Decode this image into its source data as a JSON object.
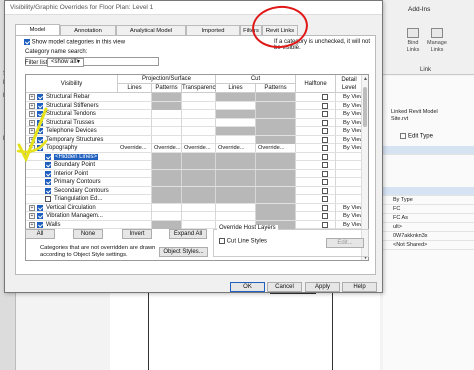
{
  "dialog": {
    "title": "Visibility/Graphic Overrides for Floor Plan: Level 1",
    "tabs": [
      {
        "label": "Model Categories"
      },
      {
        "label": "Annotation Categories"
      },
      {
        "label": "Analytical Model Categories"
      },
      {
        "label": "Imported Categories"
      },
      {
        "label": "Filters"
      },
      {
        "label": "Revit Links"
      }
    ],
    "show_model_categories_label": "Show model categories in this view",
    "note": "If a category is unchecked, it will not be visible.",
    "category_search_label": "Category name search:",
    "category_search_value": "",
    "filter_list_label": "Filter list:",
    "filter_list_value": "<show all>",
    "columns": {
      "visibility": "Visibility",
      "projection_surface": "Projection/Surface",
      "cut": "Cut",
      "halftone": "Halftone",
      "detail_level_1": "Detail",
      "detail_level_2": "Level",
      "lines": "Lines",
      "patterns": "Patterns",
      "transparency": "Transparency",
      "cut_lines": "Lines",
      "cut_patterns": "Patterns"
    },
    "rows": [
      {
        "name": "Structural Rebar",
        "detail": "By View"
      },
      {
        "name": "Structural Stiffeners",
        "detail": "By View"
      },
      {
        "name": "Structural Tendons",
        "detail": "By View"
      },
      {
        "name": "Structural Trusses",
        "detail": "By View"
      },
      {
        "name": "Telephone Devices",
        "detail": "By View"
      },
      {
        "name": "Temporary Structures",
        "detail": "By View"
      },
      {
        "name": "Topography",
        "detail": "By View",
        "override": "Override..."
      },
      {
        "name": "<Hidden Lines>",
        "detail": ""
      },
      {
        "name": "Boundary Point",
        "detail": ""
      },
      {
        "name": "Interior Point",
        "detail": ""
      },
      {
        "name": "Primary Contours",
        "detail": ""
      },
      {
        "name": "Secondary Contours",
        "detail": ""
      },
      {
        "name": "Triangulation Ed...",
        "detail": ""
      },
      {
        "name": "Vertical Circulation",
        "detail": "By View"
      },
      {
        "name": "Vibration Managem...",
        "detail": "By View"
      },
      {
        "name": "Walls",
        "detail": "By View"
      }
    ],
    "buttons": {
      "all": "All",
      "none": "None",
      "invert": "Invert",
      "expand_all": "Expand All",
      "object_styles": "Object Styles...",
      "edit": "Edit...",
      "ok": "OK",
      "cancel": "Cancel",
      "apply": "Apply",
      "help": "Help"
    },
    "info_text_1": "Categories that are not overridden are drawn",
    "info_text_2": "according to Object Style settings.",
    "override_host_layers": "Override Host Layers",
    "cut_line_styles": "Cut Line Styles"
  },
  "background": {
    "ribbon_tab": "Add-Ins",
    "ribbon_buttons": [
      "Bind Links",
      "Manage Links"
    ],
    "ribbon_panel": "Link",
    "props": [
      "Linked Revit Model",
      "Site.rvt",
      "Edit Type",
      "By Type",
      "FC",
      "FC As",
      "ult>",
      "0W7akknkn3x",
      "<Not Shared>"
    ],
    "left_letters": [
      "S",
      "M",
      "F",
      "E"
    ]
  },
  "colors": {
    "accent": "#1f5fbf",
    "annotation_red": "#e01818",
    "annotation_yellow": "#e6e21a",
    "grey_cell": "#b8b8b8"
  }
}
